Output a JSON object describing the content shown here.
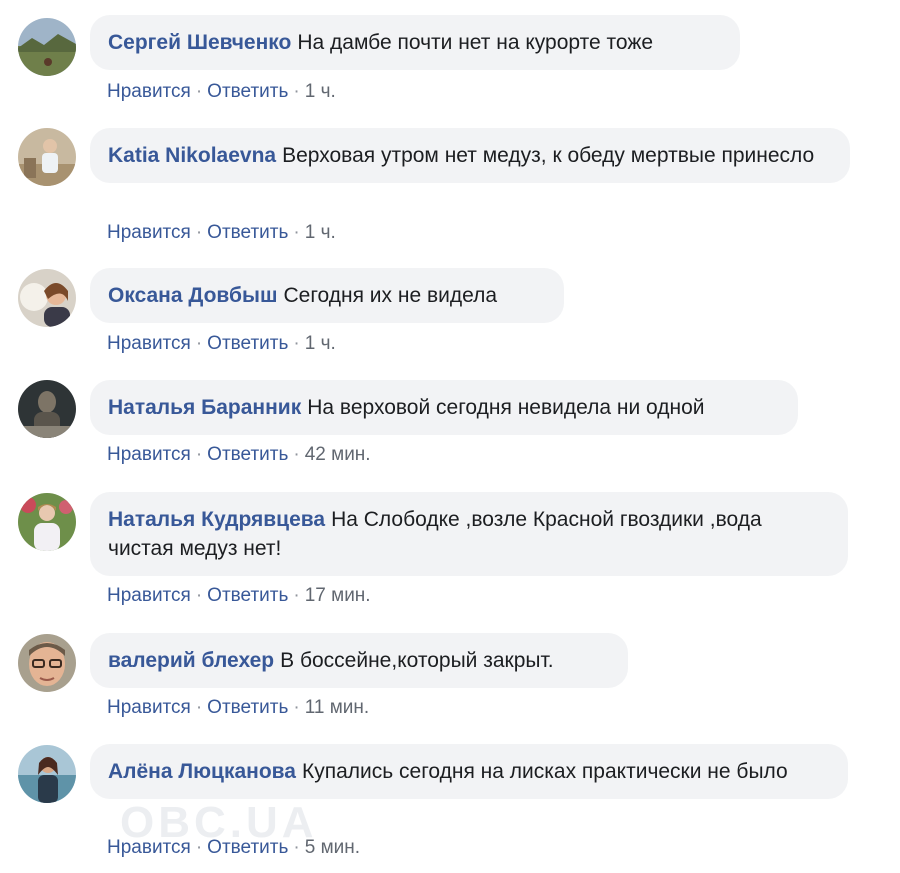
{
  "actions": {
    "like_label": "Нравится",
    "reply_label": "Ответить",
    "separator": "·"
  },
  "colors": {
    "author": "#385898",
    "bubble_bg": "#f2f3f5",
    "text": "#1c1e21",
    "meta": "#616770"
  },
  "watermark": "OBC.UA",
  "comments": [
    {
      "author": "Сергей Шевченко",
      "text": "На дамбе почти нет на курорте тоже",
      "time": "1 ч.",
      "avatar_icon": "landscape-avatar"
    },
    {
      "author": "Katia Nikolaevna",
      "text": "Верховая утром нет медуз, к обеду мертвые принесло",
      "time": "1 ч.",
      "avatar_icon": "person-outdoor-avatar"
    },
    {
      "author": "Оксана Довбыш",
      "text": "Сегодня их не видела",
      "time": "1 ч.",
      "avatar_icon": "woman-avatar"
    },
    {
      "author": "Наталья Баранник",
      "text": "На верховой сегодня невидела ни одной",
      "time": "42 мин.",
      "avatar_icon": "dark-portrait-avatar"
    },
    {
      "author": "Наталья Кудрявцева",
      "text": "На Слободке ,возле Красной гвоздики ,вода чистая медуз нет!",
      "time": "17 мин.",
      "avatar_icon": "woman-garden-avatar"
    },
    {
      "author": "валерий блехер",
      "text": "В боссейне,который закрыт.",
      "time": "11 мин.",
      "avatar_icon": "man-glasses-avatar"
    },
    {
      "author": "Алёна Люцканова",
      "text": "Купались сегодня на лисках практически не было",
      "time": "5 мин.",
      "avatar_icon": "woman-sea-avatar"
    }
  ]
}
